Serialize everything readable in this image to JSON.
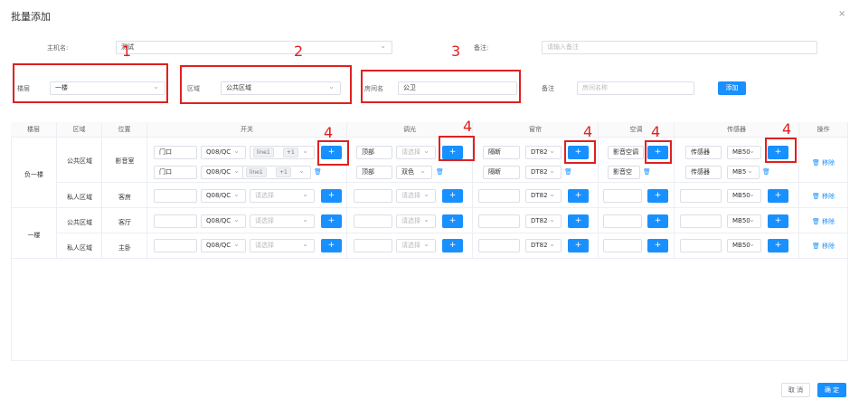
{
  "dialog": {
    "title": "批量添加",
    "close": "×"
  },
  "form": {
    "host_label": "主机名:",
    "host_value": "测试",
    "remark_label": "备注:",
    "remark_placeholder": "请输入备注",
    "floor_label": "楼层",
    "floor_value": "一楼",
    "zone_label": "区域",
    "zone_value": "公共区域",
    "room_label": "房间名",
    "room_value": "公卫",
    "note_label": "备注",
    "note_placeholder": "房间名称",
    "add_button": "添加"
  },
  "annotations": [
    "1",
    "2",
    "3",
    "4",
    "4",
    "4",
    "4",
    "4"
  ],
  "table": {
    "headers": [
      "楼层",
      "区域",
      "位置",
      "开关",
      "调光",
      "窗帘",
      "空调",
      "传感器",
      "操作"
    ],
    "floors": [
      "负一楼",
      "一楼"
    ],
    "zones": [
      "公共区域",
      "私人区域",
      "公共区域",
      "私人区域"
    ],
    "rooms": [
      "影音室",
      "客房",
      "客厅",
      "主卧"
    ],
    "placeholder": "请选择",
    "plus": "+",
    "remove": "移除",
    "r1": {
      "sw_name": "门口",
      "sw_model": "Q08/QC",
      "sw_tag": "line1",
      "sw_more": "+1",
      "dim_name": "顶部",
      "cur_name": "隔断",
      "cur_model": "DT82",
      "ac_name": "影音空调",
      "sensor_name": "传感器",
      "sensor_model": "MB50"
    },
    "r2": {
      "sw_name": "门口",
      "sw_model": "Q08/QC",
      "sw_tag": "line1",
      "sw_more": "+1",
      "dim_name": "顶部",
      "dim_model": "双色",
      "cur_name": "隔断",
      "cur_model": "DT82",
      "ac_name": "影音空",
      "sensor_name": "传感器",
      "sensor_model": "MB5"
    },
    "r3": {
      "sw_model": "Q08/QC",
      "cur_model": "DT82",
      "sensor_model": "MB50"
    },
    "r4": {
      "sw_model": "Q08/QC",
      "cur_model": "DT82",
      "sensor_model": "MB50"
    },
    "r5": {
      "sw_model": "Q08/QC",
      "cur_model": "DT82",
      "sensor_model": "MB50"
    }
  },
  "footer": {
    "cancel": "取 消",
    "ok": "确 定"
  },
  "colors": {
    "primary": "#1890ff",
    "annotation": "#e02020"
  }
}
